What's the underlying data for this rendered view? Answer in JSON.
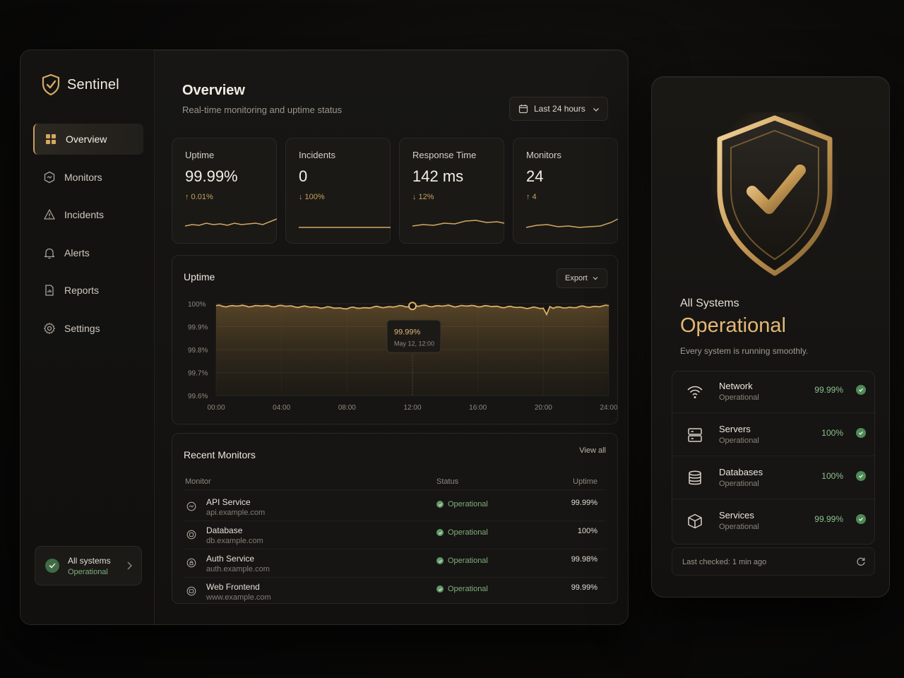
{
  "brand": {
    "name": "Sentinel"
  },
  "sidebar": {
    "items": [
      {
        "label": "Overview",
        "icon": "grid-icon",
        "active": true
      },
      {
        "label": "Monitors",
        "icon": "monitor-icon"
      },
      {
        "label": "Incidents",
        "icon": "warning-icon"
      },
      {
        "label": "Alerts",
        "icon": "bell-icon"
      },
      {
        "label": "Reports",
        "icon": "report-icon"
      },
      {
        "label": "Settings",
        "icon": "gear-icon"
      }
    ],
    "status": {
      "line1": "All systems",
      "line2": "Operational"
    }
  },
  "header": {
    "title": "Overview",
    "subtitle": "Real-time monitoring and uptime status",
    "range_label": "Last 24 hours"
  },
  "stats": [
    {
      "label": "Uptime",
      "value": "99.99%",
      "delta": "↑ 0.01%"
    },
    {
      "label": "Incidents",
      "value": "0",
      "delta": "↓ 100%"
    },
    {
      "label": "Response Time",
      "value": "142 ms",
      "delta": "↓ 12%"
    },
    {
      "label": "Monitors",
      "value": "24",
      "delta": "↑ 4"
    }
  ],
  "uptime_chart": {
    "title": "Uptime",
    "export_label": "Export",
    "tooltip": {
      "value": "99.99%",
      "time": "May 12, 12:00"
    },
    "y_ticks": [
      "100%",
      "99.9%",
      "99.8%",
      "99.7%",
      "99.6%"
    ],
    "x_ticks": [
      "00:00",
      "04:00",
      "08:00",
      "12:00",
      "16:00",
      "20:00",
      "24:00"
    ]
  },
  "chart_data": {
    "type": "area",
    "x": [
      "00:00",
      "04:00",
      "08:00",
      "12:00",
      "16:00",
      "20:00",
      "24:00"
    ],
    "series": [
      {
        "values": [
          99.99,
          99.99,
          99.98,
          99.99,
          99.99,
          99.98,
          99.99
        ]
      }
    ],
    "ylim": [
      99.6,
      100
    ],
    "grid": true
  },
  "monitors": {
    "title": "Recent Monitors",
    "view_all": "View all",
    "columns": {
      "monitor": "Monitor",
      "status": "Status",
      "uptime": "Uptime"
    },
    "rows": [
      {
        "name": "API Service",
        "host": "api.example.com",
        "status": "Operational",
        "uptime": "99.99%"
      },
      {
        "name": "Database",
        "host": "db.example.com",
        "status": "Operational",
        "uptime": "100%"
      },
      {
        "name": "Auth Service",
        "host": "auth.example.com",
        "status": "Operational",
        "uptime": "99.98%"
      },
      {
        "name": "Web Frontend",
        "host": "www.example.com",
        "status": "Operational",
        "uptime": "99.99%"
      }
    ]
  },
  "system": {
    "label": "All Systems",
    "state": "Operational",
    "subtitle": "Every system is running smoothly.",
    "services": [
      {
        "name": "Network",
        "status": "Operational",
        "value": "99.99%",
        "icon": "wifi-icon"
      },
      {
        "name": "Servers",
        "status": "Operational",
        "value": "100%",
        "icon": "server-icon"
      },
      {
        "name": "Databases",
        "status": "Operational",
        "value": "100%",
        "icon": "database-icon"
      },
      {
        "name": "Services",
        "status": "Operational",
        "value": "99.99%",
        "icon": "cube-icon"
      }
    ],
    "last_checked": "Last checked: 1 min ago"
  },
  "colors": {
    "accent": "#c9a15e",
    "ok": "#5f9966",
    "bg": "#121110"
  }
}
